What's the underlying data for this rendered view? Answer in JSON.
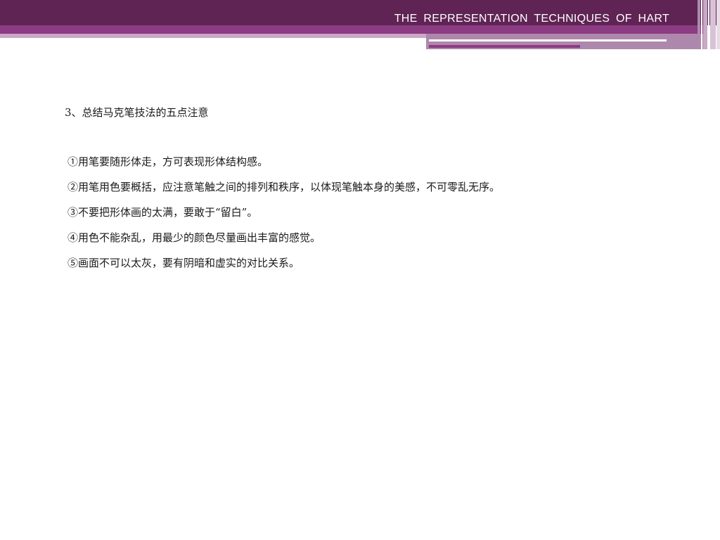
{
  "header": {
    "title": "THE  REPRESENTATION  TECHNIQUES  OF  HART"
  },
  "content": {
    "heading": "3、总结马克笔技法的五点注意",
    "points": [
      "①用笔要随形体走，方可表现形体结构感。",
      "②用笔用色要概括，应注意笔触之间的排列和秩序，以体现笔触本身的美感，不可零乱无序。",
      "③不要把形体画的太满，要敢于“留白”。",
      "④用色不能杂乱，用最少的颜色尽量画出丰富的感觉。",
      "⑤画面不可以太灰，要有阴暗和虚实的对比关系。"
    ]
  },
  "colors": {
    "header_band": "#5f2453",
    "accent": "#8b3c82",
    "light_accent": "#c9a9c6"
  }
}
